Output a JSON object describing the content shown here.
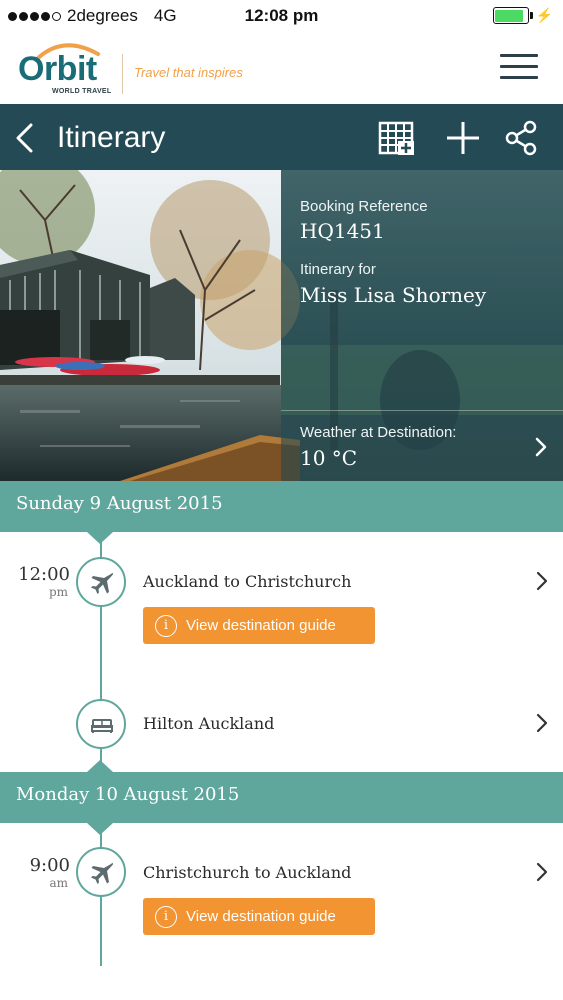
{
  "status_bar": {
    "carrier": "2degrees",
    "network": "4G",
    "time": "12:08 pm",
    "signal_bars": 4,
    "battery_level": 0.9
  },
  "brand": {
    "logo_text": "Orbit",
    "logo_subtext": "WORLD TRAVEL",
    "tagline": "Travel that inspires",
    "colors": {
      "teal": "#1a6c76",
      "orange": "#f0a14a"
    }
  },
  "nav": {
    "title": "Itinerary",
    "icons": [
      "back-chevron-icon",
      "calendar-add-icon",
      "plus-icon",
      "share-icon"
    ]
  },
  "hero": {
    "booking_reference_label": "Booking Reference",
    "booking_reference": "HQ1451",
    "itinerary_for_label": "Itinerary for",
    "traveller_name": "Miss Lisa Shorney",
    "weather_label": "Weather at Destination:",
    "weather_value": "10 °C"
  },
  "days": [
    {
      "title": "Sunday 9 August 2015",
      "events": [
        {
          "time": "12:00",
          "ampm": "pm",
          "icon": "plane-icon",
          "title": "Auckland to Christchurch",
          "action_label": "View destination guide"
        },
        {
          "icon": "bed-icon",
          "title": "Hilton Auckland"
        }
      ]
    },
    {
      "title": "Monday 10 August 2015",
      "events": [
        {
          "time": "9:00",
          "ampm": "am",
          "icon": "plane-icon",
          "title": "Christchurch to Auckland",
          "action_label": "View destination guide"
        }
      ]
    }
  ],
  "colors": {
    "nav_bg": "#244a55",
    "day_header_bg": "#5fa79c",
    "button_orange": "#f19431"
  }
}
